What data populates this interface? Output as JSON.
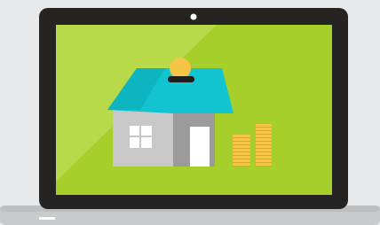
{
  "scene": {
    "subject": "laptop-with-house-and-coins",
    "icons": [
      "laptop-icon",
      "house-icon",
      "coin-slot-icon",
      "coin-stack-icon",
      "window-icon",
      "door-icon",
      "camera-dot-icon"
    ]
  },
  "colors": {
    "background": "#e8e9ea",
    "bezel": "#252423",
    "screen": "#a6cf2c",
    "screen_highlight": "#b7d94a",
    "roof": "#12c4cf",
    "house_wall_left": "#c8c8c8",
    "house_wall_right": "#9b9b9b",
    "door": "#ffffff",
    "window": "#ffffff",
    "coin": "#f6c447",
    "coin_shadow": "#d8a92f",
    "base": "#c9cacc",
    "base_dark": "#bdbec0"
  }
}
